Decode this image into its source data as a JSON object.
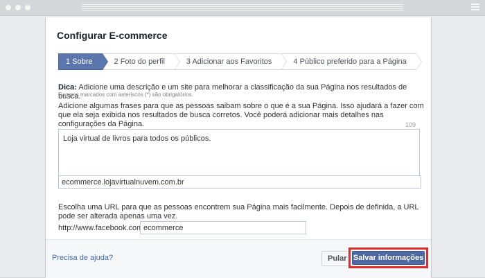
{
  "dialog": {
    "title": "Configurar E-commerce",
    "steps": [
      {
        "label": "1 Sobre",
        "active": true
      },
      {
        "label": "2 Foto do perfil",
        "active": false
      },
      {
        "label": "3 Adicionar aos Favoritos",
        "active": false
      },
      {
        "label": "4 Público preferido para a Página",
        "active": false
      }
    ],
    "hint_label": "Dica:",
    "hint_text": " Adicione uma descrição e um site para melhorar a classificação da sua Página nos resultados de busca.",
    "required_note": "Campos marcados com asteriscos (*) são obrigatórios.",
    "description_prompt": "Adicione algumas frases para que as pessoas saibam sobre o que é a sua Página. Isso ajudará a fazer com que ela seja exibida nos resultados de busca corretos. Você poderá adicionar mais detalhes nas configurações da Página.",
    "char_counter": "109",
    "description_value": "Loja virtual de livros para todos os públicos.",
    "website_value": "ecommerce.lojavirtualnuvem.com.br",
    "url_prompt": "Escolha uma URL para que as pessoas encontrem sua Página mais facilmente. Depois de definida, a URL pode ser alterada apenas uma vez.",
    "fb_prefix": "http://www.facebook.com/",
    "fb_username_value": "ecommerce"
  },
  "footer": {
    "help_link": "Precisa de ajuda?",
    "skip_label": "Pular",
    "save_label": "Salvar informações"
  },
  "colors": {
    "active_step": "#5b75ad",
    "primary_button": "#4e69a2",
    "highlight_border": "#e02b2b",
    "link": "#4267b2"
  }
}
